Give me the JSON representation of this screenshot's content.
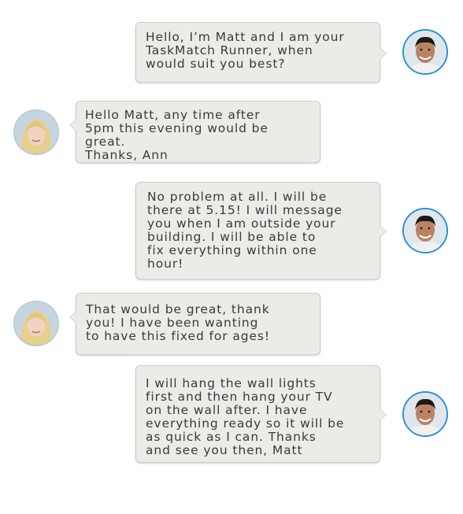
{
  "conversation": {
    "colors": {
      "bubble_fill": "#ecebe7",
      "bubble_border": "#cfcdc8",
      "text": "#3a3a3a",
      "matt_avatar_ring": "#2a91d6"
    },
    "messages": [
      {
        "sender": "Matt",
        "side": "right",
        "avatar": "man-avatar",
        "text": "Hello, I’m Matt and I am your\nTaskMatch Runner, when\nwould suit you best?"
      },
      {
        "sender": "Ann",
        "side": "left",
        "avatar": "woman-avatar",
        "text": "Hello Matt, any time after\n5pm this evening would be\ngreat.\nThanks, Ann"
      },
      {
        "sender": "Matt",
        "side": "right",
        "avatar": "man-avatar",
        "text": "No problem at all. I will be\nthere at 5.15! I will message\nyou when I am outside your\nbuilding. I will be able to\nfix everything within one\nhour!"
      },
      {
        "sender": "Ann",
        "side": "left",
        "avatar": "woman-avatar",
        "text": "That would be great, thank\nyou! I have been wanting\nto have this fixed for ages!"
      },
      {
        "sender": "Matt",
        "side": "right",
        "avatar": "man-avatar",
        "text": "I will hang the wall lights\nfirst and then hang your TV\non the wall after. I have\neverything ready so it will be\nas quick as I can. Thanks\nand see you then, Matt"
      }
    ]
  }
}
